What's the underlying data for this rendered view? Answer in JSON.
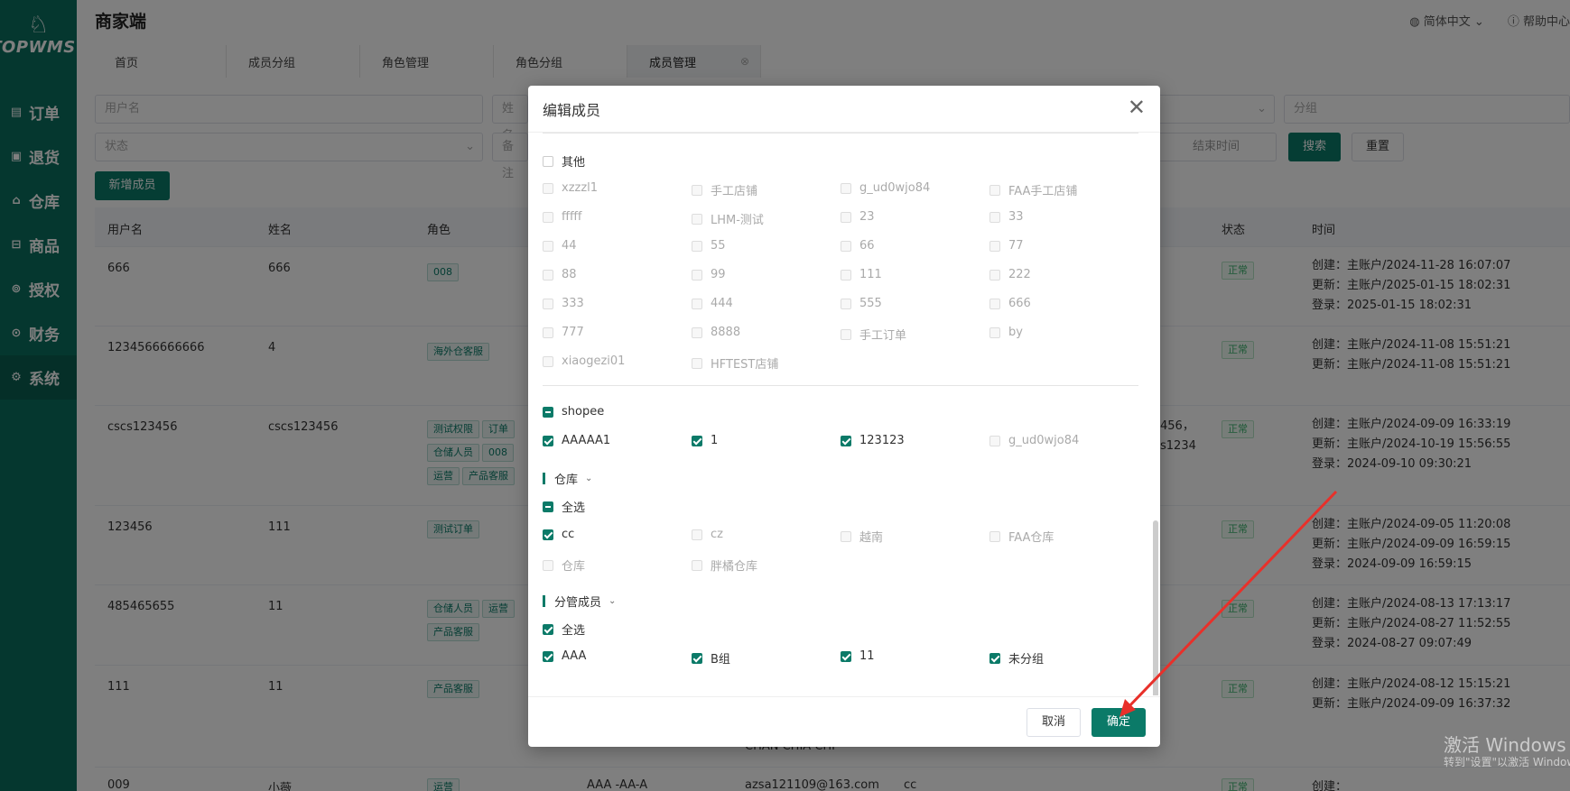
{
  "sidebar": {
    "logo_text": "TOPWMS",
    "items": [
      {
        "label": "订单"
      },
      {
        "label": "退货"
      },
      {
        "label": "仓库"
      },
      {
        "label": "商品"
      },
      {
        "label": "授权"
      },
      {
        "label": "财务"
      },
      {
        "label": "系统"
      }
    ]
  },
  "header": {
    "title": "商家端",
    "language": "简体中文",
    "help": "帮助中心"
  },
  "tabs": [
    "首页",
    "成员分组",
    "角色管理",
    "角色分组",
    "成员管理"
  ],
  "filters": {
    "username_placeholder": "用户名",
    "name_placeholder": "姓名",
    "group_placeholder": "分组",
    "status_placeholder": "状态",
    "remark_placeholder": "备注",
    "end_time_placeholder": "结束时间",
    "search_label": "搜索",
    "reset_label": "重置",
    "add_member_label": "新增成员"
  },
  "table": {
    "headers": {
      "username": "用户名",
      "name": "姓名",
      "role": "角色",
      "status": "状态",
      "time": "时间"
    },
    "rows": [
      {
        "username": "666",
        "name": "666",
        "tags": [
          "008"
        ],
        "status": "正常",
        "times": [
          "创建：主账户/2024-11-28 16:07:07",
          "更新：主账户/2025-01-15 18:02:31",
          "登录：2025-01-15 18:02:31"
        ]
      },
      {
        "username": "1234566666666",
        "name": "4",
        "tags": [
          "海外仓客服"
        ],
        "status": "正常",
        "times": [
          "创建：主账户/2024-11-08 15:51:21",
          "更新：主账户/2024-11-08 15:51:21"
        ]
      },
      {
        "username": "cscs123456",
        "name": "cscs123456",
        "tags": [
          "测试权限",
          "订单",
          "仓储人员",
          "008",
          "运营",
          "产品客服"
        ],
        "status": "正常",
        "extra": [
          "456，",
          "s1234"
        ],
        "times": [
          "创建：主账户/2024-09-09 16:33:19",
          "更新：主账户/2024-10-19 15:56:55",
          "登录：2024-09-10 09:30:21"
        ]
      },
      {
        "username": "123456",
        "name": "111",
        "tags": [
          "测试订单"
        ],
        "status": "正常",
        "times": [
          "创建：主账户/2024-09-05 11:20:08",
          "更新：主账户/2024-09-09 16:59:15",
          "登录：2024-09-09 16:59:15"
        ]
      },
      {
        "username": "485465655",
        "name": "11",
        "tags": [
          "仓储人员",
          "运营",
          "产品客服"
        ],
        "status": "正常",
        "times": [
          "创建：主账户/2024-08-13 17:13:17",
          "更新：主账户/2024-08-27 11:52:55",
          "登录：2024-08-27 09:07:49"
        ]
      },
      {
        "username": "111",
        "name": "11",
        "tags": [
          "产品客服"
        ],
        "status": "正常",
        "times": [
          "创建：主账户/2024-08-12 15:15:21",
          "更新：主账户/2024-09-09 16:37:32"
        ]
      },
      {
        "username": "009",
        "name": "小薇",
        "tags": [
          "运营"
        ],
        "status": "正常",
        "extra_name": "AAA -AA-A",
        "extra_email": "azsa121109@163.com",
        "extra_cc": "cc",
        "times": [
          "创建："
        ]
      }
    ],
    "overflow_text": "CHAN CHIA CHI"
  },
  "modal": {
    "title": "编辑成员",
    "other_label": "其他",
    "other_shops": [
      "xzzzl1",
      "手工店铺",
      "g_ud0wjo84",
      "FAA手工店铺",
      "fffff",
      "LHM-测试",
      "23",
      "33",
      "44",
      "55",
      "66",
      "77",
      "88",
      "99",
      "111",
      "222",
      "333",
      "444",
      "555",
      "666",
      "777",
      "8888",
      "手工订单",
      "by",
      "xiaogezi01",
      "HFTEST店铺"
    ],
    "shopee_label": "shopee",
    "shopee_shops": [
      {
        "label": "AAAAA1",
        "checked": true
      },
      {
        "label": "1",
        "checked": true
      },
      {
        "label": "123123",
        "checked": true
      },
      {
        "label": "g_ud0wjo84",
        "checked": false
      }
    ],
    "warehouse_section": "仓库",
    "warehouse_all": "全选",
    "warehouses": [
      {
        "label": "cc",
        "checked": true
      },
      {
        "label": "cz",
        "checked": false
      },
      {
        "label": "越南",
        "checked": false
      },
      {
        "label": "FAA仓库",
        "checked": false
      },
      {
        "label": "仓库",
        "checked": false
      },
      {
        "label": "胖橘仓库",
        "checked": false
      }
    ],
    "members_section": "分管成员",
    "members_all": "全选",
    "members": [
      {
        "label": "AAA",
        "checked": true
      },
      {
        "label": "B组",
        "checked": true
      },
      {
        "label": "11",
        "checked": true
      },
      {
        "label": "未分组",
        "checked": true
      }
    ],
    "cancel_label": "取消",
    "confirm_label": "确定"
  },
  "watermark": {
    "line1": "激活 Windows",
    "line2": "转到\"设置\"以激活 Windows。"
  },
  "colors": {
    "primary": "#0b7a68",
    "sidebar": "#0b6e5e",
    "arrow": "#e8302a"
  }
}
